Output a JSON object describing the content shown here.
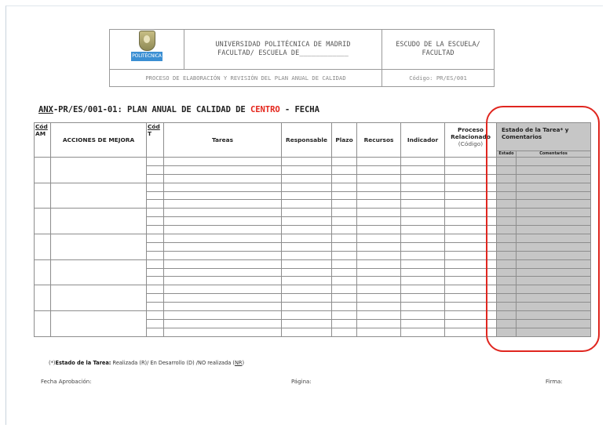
{
  "header": {
    "logo_text": "POLITÉCNICA",
    "university_line1": "UNIVERSIDAD POLITÉCNICA DE MADRID",
    "university_line2": "FACULTAD/ ESCUELA DE____________",
    "escudo_line1": "ESCUDO DE LA ESCUELA/",
    "escudo_line2": "FACULTAD",
    "process_title": "PROCESO DE ELABORACIÓN Y REVISIÓN DEL PLAN ANUAL DE CALIDAD",
    "code_label": "Código: PR/ES/001"
  },
  "title": {
    "prefix": "ANX",
    "part1": "-PR/ES/001-01: PLAN ANUAL DE CALIDAD DE ",
    "highlight": "CENTRO",
    "part2": " - FECHA"
  },
  "table": {
    "col_cod_am_1": "Cód",
    "col_cod_am_2": "AM",
    "col_acciones": "ACCIONES DE MEJORA",
    "col_cod_t_1": "Cód",
    "col_cod_t_2": "T",
    "col_tareas": "Tareas",
    "col_responsable": "Responsable",
    "col_plazo": "Plazo",
    "col_recursos": "Recursos",
    "col_indicador": "Indicador",
    "col_proceso_1": "Proceso",
    "col_proceso_2": "Relacionado",
    "col_proceso_3": "(Código)",
    "col_estado_1": "Estado de la Tarea* y",
    "col_estado_2": "Comentarios",
    "sub_estado": "Estado",
    "sub_comentarios": "Comentarios"
  },
  "footnote": {
    "marker": "(*)",
    "label": "Estado de la Tarea:",
    "text_a": " Realizada (R)/ En Desarrollo (D) /NO realizada (",
    "nr": "NR",
    "text_b": ")"
  },
  "footer": {
    "fecha": "Fecha Aprobación:",
    "pagina": "Página:",
    "firma": "Firma:"
  },
  "colors": {
    "highlight": "#e4261c",
    "annotation": "#e0261f",
    "gray_fill": "#c6c6c6"
  }
}
